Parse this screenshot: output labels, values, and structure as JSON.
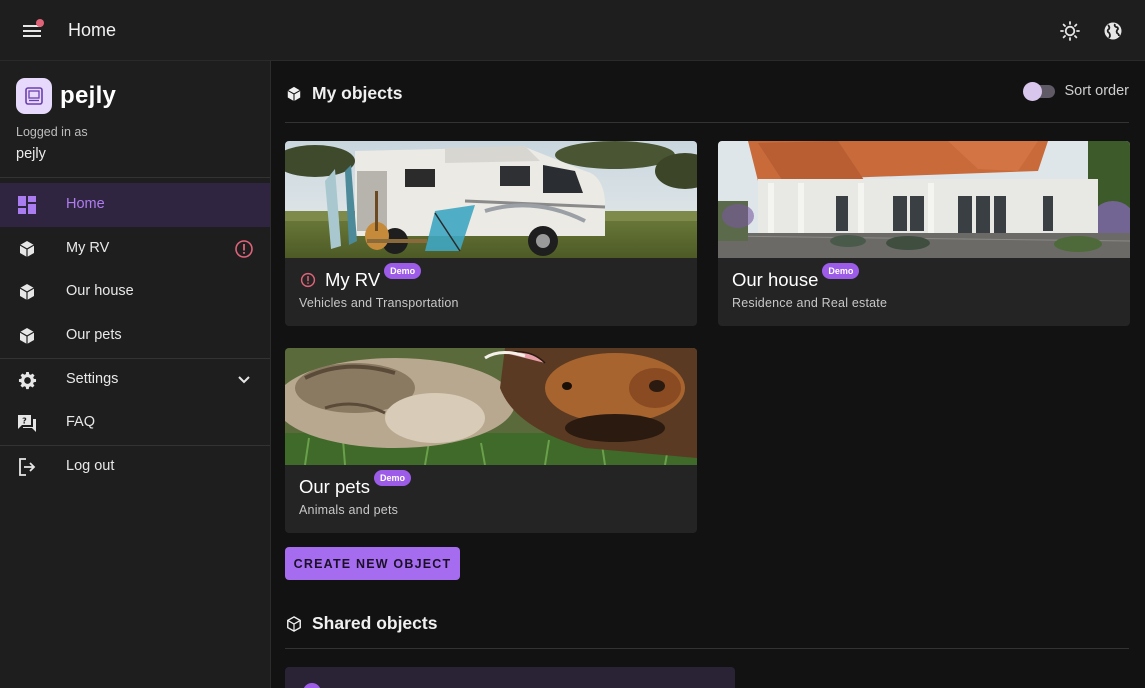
{
  "appbar": {
    "title": "Home",
    "icons": [
      "menu-icon",
      "brightness-icon",
      "globe-icon"
    ]
  },
  "sidebar": {
    "brand": "pejly",
    "logged_in_label": "Logged in as",
    "username": "pejly",
    "items": [
      {
        "label": "Home",
        "icon": "dashboard-icon",
        "active": true
      },
      {
        "label": "My RV",
        "icon": "cube-icon",
        "alert": true
      },
      {
        "label": "Our house",
        "icon": "cube-icon"
      },
      {
        "label": "Our pets",
        "icon": "cube-icon"
      },
      {
        "label": "Settings",
        "icon": "gear-icon",
        "expandable": true
      },
      {
        "label": "FAQ",
        "icon": "faq-icon"
      },
      {
        "label": "Log out",
        "icon": "logout-icon"
      }
    ]
  },
  "main": {
    "my_objects_title": "My objects",
    "sort_label": "Sort order",
    "cards": [
      {
        "title": "My RV",
        "badge": "Demo",
        "subtitle": "Vehicles and Transportation",
        "alert": true
      },
      {
        "title": "Our house",
        "badge": "Demo",
        "subtitle": "Residence and Real estate"
      },
      {
        "title": "Our pets",
        "badge": "Demo",
        "subtitle": "Animals and pets"
      }
    ],
    "create_button": "CREATE NEW OBJECT",
    "shared_objects_title": "Shared objects"
  },
  "colors": {
    "accent": "#a66cf0",
    "badge": "#9c5ce8",
    "alert": "#e0637a",
    "active_bg": "#2f2540"
  }
}
